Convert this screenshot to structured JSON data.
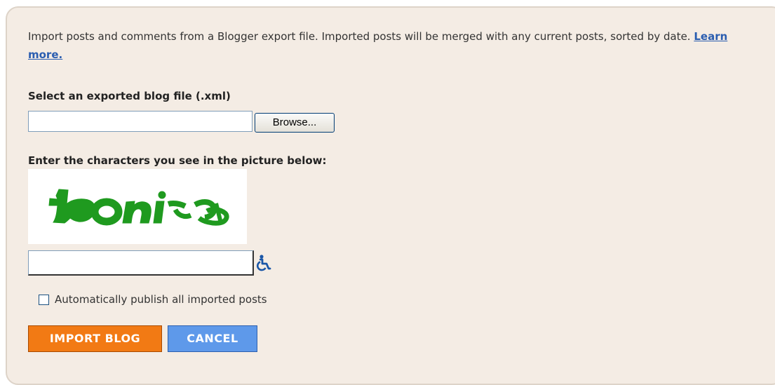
{
  "intro": {
    "text": "Import posts and comments from a Blogger export file. Imported posts will be merged with any current posts, sorted by date.",
    "learn_more": "Learn more."
  },
  "file_section": {
    "label": "Select an exported blog file (.xml)",
    "file_value": "",
    "browse_label": "Browse..."
  },
  "captcha": {
    "label": "Enter the characters you see in the picture below:",
    "image_text": "toniusp",
    "input_value": "",
    "accessibility_icon": "wheelchair-icon"
  },
  "options": {
    "auto_publish_label": "Automatically publish all imported posts",
    "auto_publish_checked": false
  },
  "actions": {
    "import_label": "IMPORT BLOG",
    "cancel_label": "CANCEL"
  },
  "colors": {
    "panel_bg": "#f4ece4",
    "link": "#2a5db0",
    "import_button": "#f27a14",
    "cancel_button": "#5e99ea",
    "captcha_green": "#1f9a1f"
  }
}
